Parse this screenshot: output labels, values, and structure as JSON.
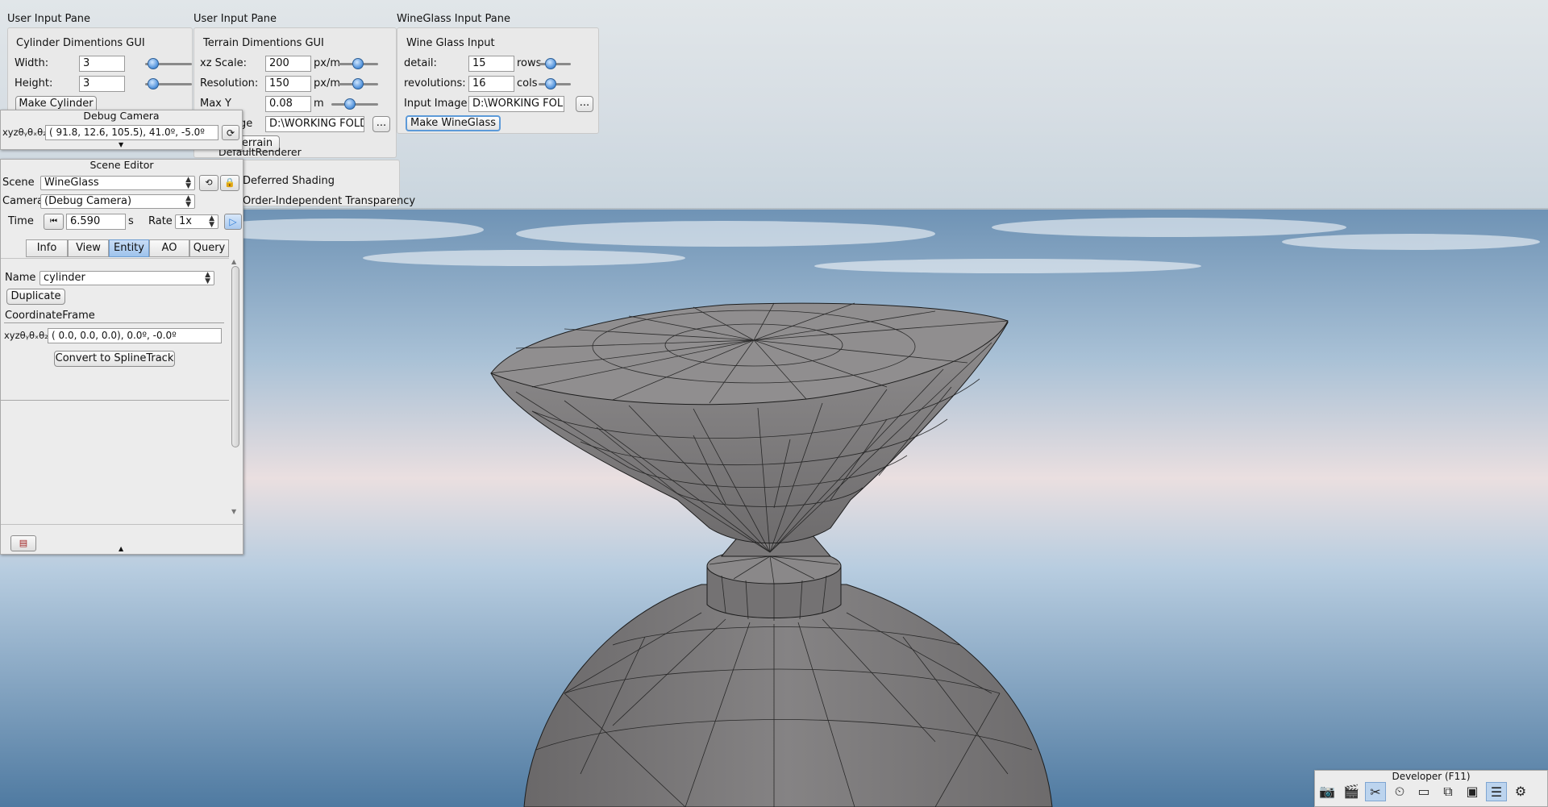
{
  "cylinder_pane": {
    "pane_title": "User Input Pane",
    "group_title": "Cylinder Dimentions GUI",
    "width_label": "Width:",
    "width_value": "3",
    "width_slider": 0.15,
    "height_label": "Height:",
    "height_value": "3",
    "height_slider": 0.15,
    "make_button": "Make Cylinder"
  },
  "terrain_pane": {
    "pane_title": "User Input Pane",
    "group_title": "Terrain Dimentions GUI",
    "xz_label": "xz Scale:",
    "xz_value": "200",
    "xz_unit": "px/m",
    "xz_slider": 0.55,
    "res_label": "Resolution:",
    "res_value": "150",
    "res_unit": "px/m",
    "res_slider": 0.55,
    "maxy_label": "Max Y",
    "maxy_value": "0.08",
    "maxy_unit": "m",
    "maxy_slider": 0.35,
    "image_label": "ge",
    "image_value": "D:\\WORKING FOLD",
    "browse_button": "...",
    "make_button": "errain"
  },
  "wineglass_pane": {
    "pane_title": "WineGlass Input Pane",
    "group_title": "Wine Glass Input",
    "detail_label": "detail:",
    "detail_value": "15",
    "detail_unit": "rows",
    "detail_slider": 0.5,
    "rev_label": "revolutions:",
    "rev_value": "16",
    "rev_unit": "cols",
    "rev_slider": 0.5,
    "image_label": "Input Image",
    "image_value": "D:\\WORKING FOLD",
    "browse_button": "...",
    "make_button": "Make WineGlass"
  },
  "renderer_pane": {
    "title": "DefaultRenderer",
    "deferred_label": "Deferred Shading",
    "oit_label": "Order-Independent Transparency"
  },
  "debug_camera": {
    "title": "Debug Camera",
    "coord_label": "xyzθᵧθₓθ₂",
    "coord_value": "( 91.8,  12.6,  105.5),  41.0º,  -5.0º"
  },
  "scene_editor": {
    "title": "Scene Editor",
    "scene_label": "Scene",
    "scene_value": "WineGlass",
    "camera_label": "Camera",
    "camera_value": "(Debug Camera)",
    "time_label": "Time",
    "time_value": "6.590",
    "time_unit": "s",
    "rate_label": "Rate",
    "rate_value": "1x",
    "tabs": [
      "Info",
      "View",
      "Entity",
      "AO",
      "Query"
    ],
    "active_tab": "Entity",
    "name_label": "Name",
    "name_value": "cylinder",
    "duplicate_button": "Duplicate",
    "frame_heading": "CoordinateFrame",
    "frame_label": "xyzθᵧθₓθ₂",
    "frame_value": "(  0.0,   0.0,   0.0),   0.0º,  -0.0º",
    "spline_button": "Convert to SplineTrack"
  },
  "developer": {
    "title": "Developer (F11)",
    "icons": [
      "camera-icon",
      "film-icon",
      "tools-icon",
      "clock-icon",
      "folder-icon",
      "window-icon",
      "profiler-icon",
      "log-icon",
      "gear-icon"
    ]
  }
}
